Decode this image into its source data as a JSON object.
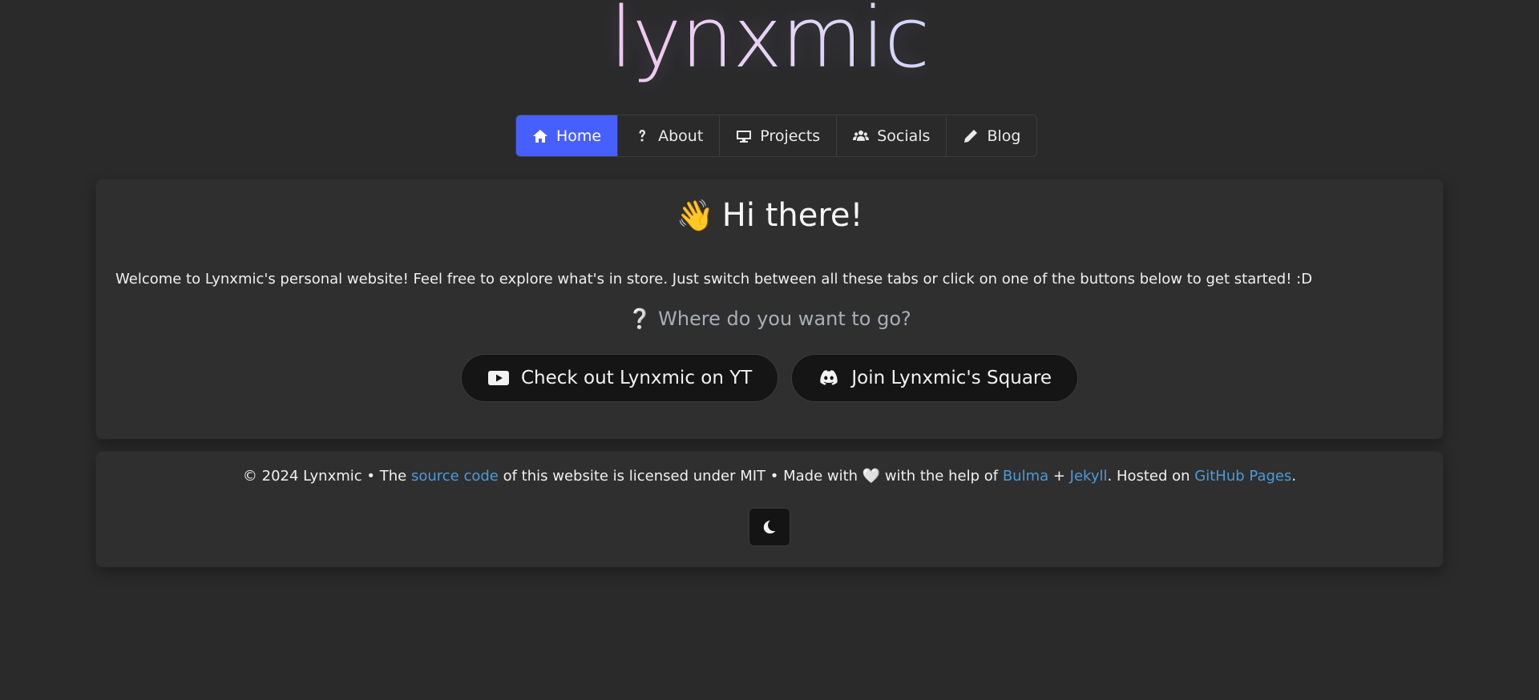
{
  "logo": {
    "text": "lynxmic"
  },
  "nav": {
    "tabs": [
      {
        "label": "Home",
        "icon": "home-icon",
        "active": true
      },
      {
        "label": "About",
        "icon": "question-icon",
        "active": false
      },
      {
        "label": "Projects",
        "icon": "desktop-icon",
        "active": false
      },
      {
        "label": "Socials",
        "icon": "users-icon",
        "active": false
      },
      {
        "label": "Blog",
        "icon": "pencil-icon",
        "active": false
      }
    ],
    "active_color": "#485fff"
  },
  "main": {
    "heading_emoji": "👋",
    "heading": "Hi there!",
    "welcome": "Welcome to Lynxmic's personal website! Feel free to explore what's in store. Just switch between all these tabs or click on one of the buttons below to get started! :D",
    "question_mark": "❔",
    "question": "Where do you want to go?",
    "buttons": [
      {
        "label": "Check out Lynxmic on YT",
        "icon": "youtube-icon"
      },
      {
        "label": "Join Lynxmic's Square",
        "icon": "discord-icon"
      }
    ]
  },
  "footer": {
    "part1": "© 2024 Lynxmic • The ",
    "source_link": "source code",
    "part2": " of this website is licensed under MIT • Made with ",
    "heart": "🤍",
    "part3": " with the help of ",
    "bulma_link": "Bulma",
    "plus": " + ",
    "jekyll_link": "Jekyll",
    "part4": ". Hosted on ",
    "github_link": "GitHub Pages",
    "part5": ".",
    "theme_toggle_icon": "moon-icon",
    "link_color": "#4d9ad8"
  }
}
